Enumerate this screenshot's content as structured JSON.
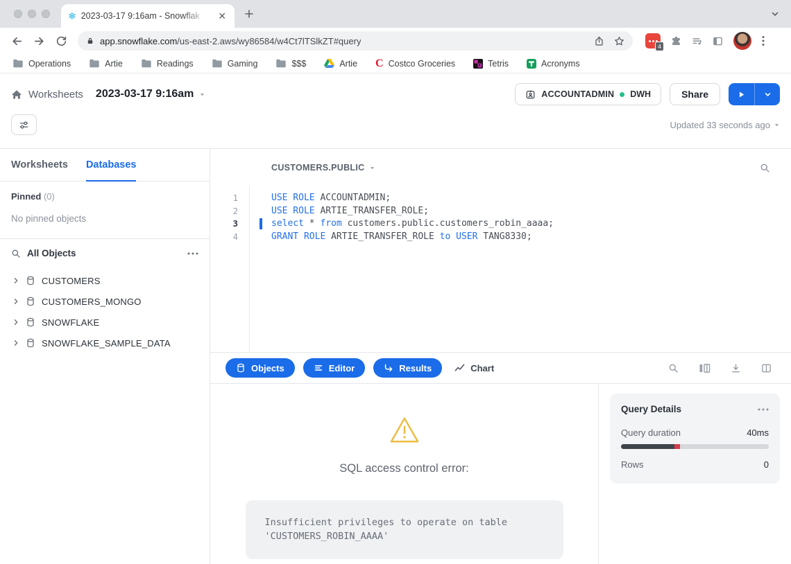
{
  "colors": {
    "accent": "#1a6ce8",
    "warning": "#edbc42",
    "green_dot": "#24c08b",
    "progress_dark": "#3f444b",
    "progress_red": "#d83b4b"
  },
  "browser": {
    "tab_title": "2023-03-17 9:16am - Snowflak",
    "url_domain": "app.snowflake.com",
    "url_path": "/us-east-2.aws/wy86584/w4Ct7lTSlkZT#query",
    "extension_badge": "4",
    "bookmarks": [
      {
        "label": "Operations",
        "icon": "folder-icon"
      },
      {
        "label": "Artie",
        "icon": "folder-icon"
      },
      {
        "label": "Readings",
        "icon": "folder-icon"
      },
      {
        "label": "Gaming",
        "icon": "folder-icon"
      },
      {
        "label": "$$$",
        "icon": "folder-icon"
      },
      {
        "label": "Artie",
        "icon": "drive-icon"
      },
      {
        "label": "Costco Groceries",
        "icon": "costco-icon"
      },
      {
        "label": "Tetris",
        "icon": "tetris-icon"
      },
      {
        "label": "Acronyms",
        "icon": "acronyms-icon"
      }
    ]
  },
  "header": {
    "breadcrumb": "Worksheets",
    "title": "2023-03-17 9:16am",
    "role": "ACCOUNTADMIN",
    "warehouse": "DWH",
    "share_label": "Share",
    "updated": "Updated 33 seconds ago"
  },
  "sidebar": {
    "tabs": [
      {
        "label": "Worksheets",
        "active": false
      },
      {
        "label": "Databases",
        "active": true
      }
    ],
    "pinned_label": "Pinned",
    "pinned_count": "(0)",
    "pinned_empty": "No pinned objects",
    "objects_label": "All Objects",
    "tree": [
      {
        "label": "CUSTOMERS",
        "icon": "database-icon"
      },
      {
        "label": "CUSTOMERS_MONGO",
        "icon": "database-icon"
      },
      {
        "label": "SNOWFLAKE",
        "icon": "database-icon"
      },
      {
        "label": "SNOWFLAKE_SAMPLE_DATA",
        "icon": "database-icon"
      }
    ]
  },
  "editor": {
    "context": "CUSTOMERS.PUBLIC",
    "active_line": 3,
    "lines": [
      [
        {
          "t": "USE ROLE ",
          "k": "kw"
        },
        {
          "t": "ACCOUNTADMIN;",
          "k": "pl"
        }
      ],
      [
        {
          "t": "USE ROLE ",
          "k": "kw"
        },
        {
          "t": "ARTIE_TRANSFER_ROLE;",
          "k": "pl"
        }
      ],
      [
        {
          "t": "select ",
          "k": "kw"
        },
        {
          "t": "* ",
          "k": "pl"
        },
        {
          "t": "from ",
          "k": "kw"
        },
        {
          "t": "customers.public.customers_robin_aaaa;",
          "k": "pl"
        }
      ],
      [
        {
          "t": "GRANT ROLE ",
          "k": "kw"
        },
        {
          "t": "ARTIE_TRANSFER_ROLE ",
          "k": "pl"
        },
        {
          "t": "to ",
          "k": "kw"
        },
        {
          "t": "USER ",
          "k": "kw"
        },
        {
          "t": "TANG8330;",
          "k": "pl"
        }
      ]
    ]
  },
  "tabbar": {
    "pills": [
      {
        "label": "Objects",
        "icon": "database-icon",
        "active": true
      },
      {
        "label": "Editor",
        "icon": "editor-lines-icon",
        "active": true
      },
      {
        "label": "Results",
        "icon": "results-arrow-icon",
        "active": true
      },
      {
        "label": "Chart",
        "icon": "chart-line-icon",
        "active": false
      }
    ]
  },
  "results": {
    "error_title": "SQL access control error:",
    "error_message": "Insufficient privileges to operate on table 'CUSTOMERS_ROBIN_AAAA'"
  },
  "query_details": {
    "title": "Query Details",
    "duration_label": "Query duration",
    "duration_value": "40ms",
    "rows_label": "Rows",
    "rows_value": "0",
    "progress": {
      "dark_pct": 36,
      "red_pct": 4
    }
  }
}
